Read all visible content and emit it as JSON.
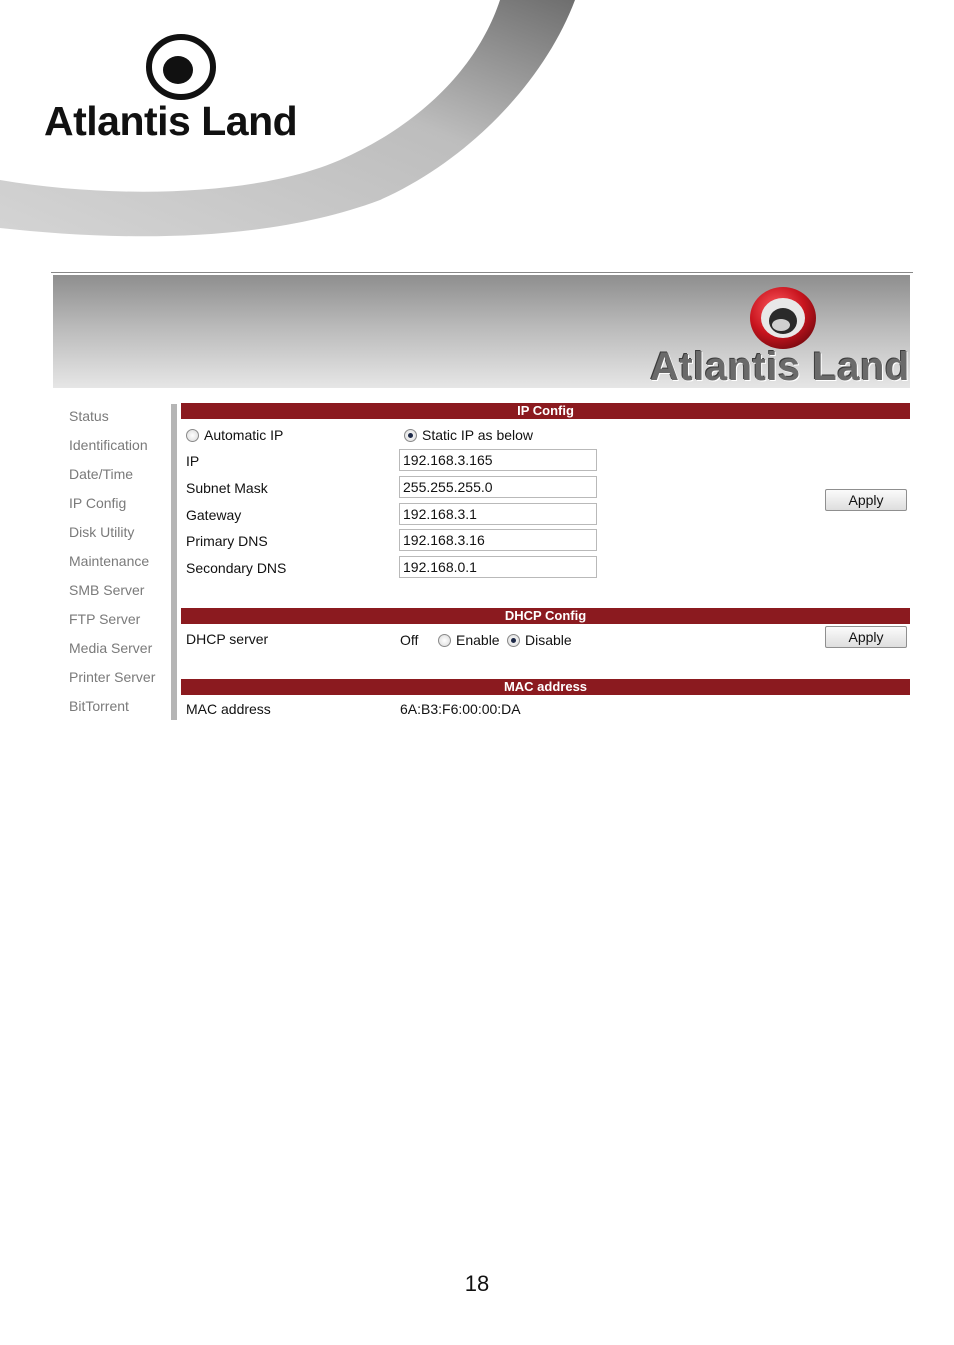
{
  "document": {
    "logo_text": "Atlantis Land",
    "page_number": "18"
  },
  "banner": {
    "logo_text": "Atlantis Land"
  },
  "nav": {
    "items": [
      "Status",
      "Identification",
      "Date/Time",
      "IP Config",
      "Disk Utility",
      "Maintenance",
      "SMB Server",
      "FTP Server",
      "Media Server",
      "Printer Server",
      "BitTorrent"
    ]
  },
  "ip_config": {
    "title": "IP Config",
    "mode_automatic": "Automatic IP",
    "mode_static": "Static IP as below",
    "selected_mode": "static",
    "ip_label": "IP",
    "ip_value": "192.168.3.165",
    "subnet_label": "Subnet Mask",
    "subnet_value": "255.255.255.0",
    "gateway_label": "Gateway",
    "gateway_value": "192.168.3.1",
    "primary_dns_label": "Primary DNS",
    "primary_dns_value": "192.168.3.16",
    "secondary_dns_label": "Secondary DNS",
    "secondary_dns_value": "192.168.0.1",
    "apply_label": "Apply"
  },
  "dhcp_config": {
    "title": "DHCP Config",
    "server_label": "DHCP server",
    "status": "Off",
    "enable_label": "Enable",
    "disable_label": "Disable",
    "selected": "disable",
    "apply_label": "Apply"
  },
  "mac": {
    "title": "MAC address",
    "label": "MAC address",
    "value": "6A:B3:F6:00:00:DA"
  },
  "colors": {
    "section_bar": "#8b1a1f",
    "logo_red": "#c8141e",
    "nav_text": "#7a7a7a"
  }
}
